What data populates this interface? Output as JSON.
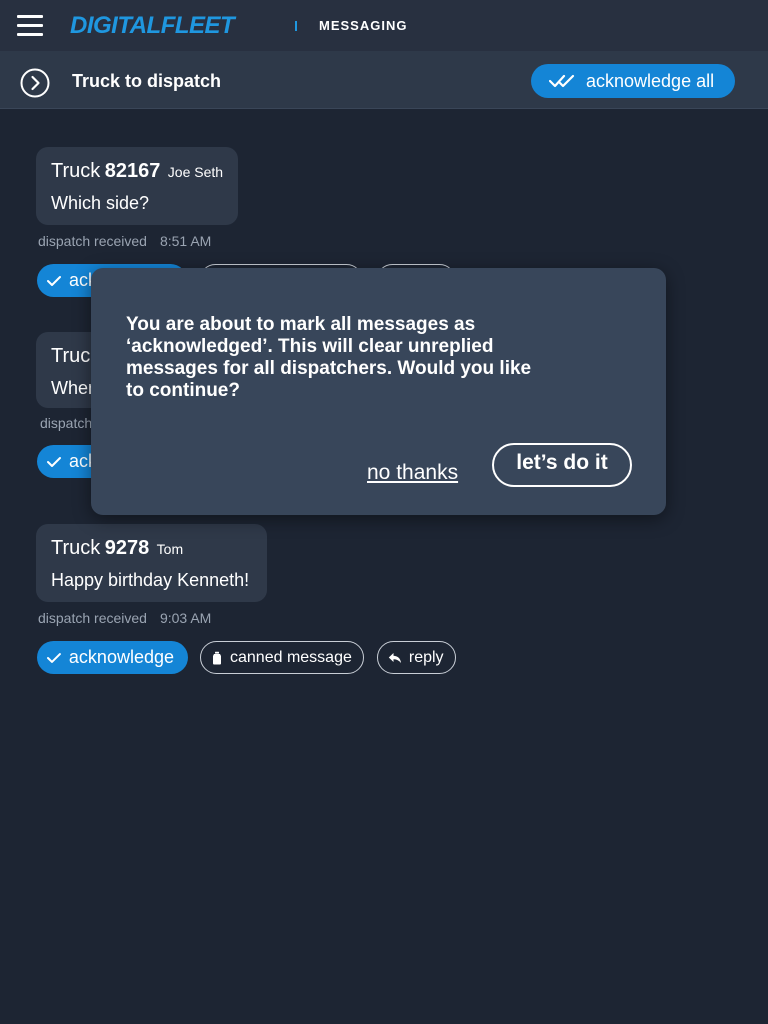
{
  "topbar": {
    "brand": "DIGITALFLEET",
    "section": "MESSAGING",
    "menu_icon": "hamburger-menu-icon",
    "brand_color": "#1f97e0"
  },
  "subheader": {
    "title": "Truck to dispatch",
    "nav_icon": "circle-chevron-right-icon",
    "acknowledge_all_label": "acknowledge all",
    "acknowledge_all_icon": "double-check-icon",
    "accent_color": "#1485d6"
  },
  "messages": [
    {
      "truck_word": "Truck",
      "truck_number": "82167",
      "driver": "Joe Seth",
      "text": "Which side?",
      "status": "dispatch received",
      "time": "8:51 AM",
      "acknowledge_label": "ack"
    },
    {
      "truck_word": "Truc",
      "truck_number": "",
      "driver": "",
      "text": "When",
      "status": "dispatch",
      "time": "",
      "acknowledge_label": "ack"
    },
    {
      "truck_word": "Truck",
      "truck_number": "9278",
      "driver": "Tom",
      "text": "Happy birthday Kenneth!",
      "status": "dispatch received",
      "time": "9:03 AM",
      "acknowledge_label": "acknowledge",
      "canned_label": "canned message",
      "reply_label": "reply"
    }
  ],
  "modal": {
    "message": "You are about to mark all messages as ‘acknowledged’. This will clear unreplied messages for all dispatchers. Would you like to continue?",
    "cancel_label": "no thanks",
    "confirm_label": "let’s do it"
  }
}
